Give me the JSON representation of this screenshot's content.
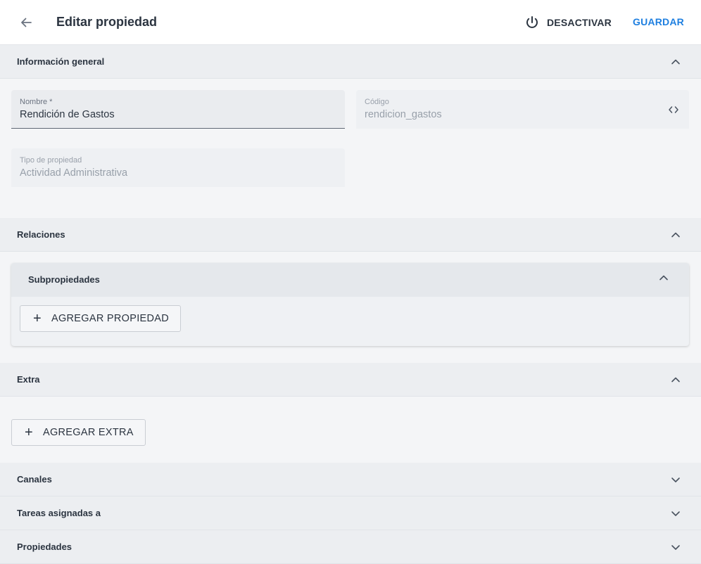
{
  "header": {
    "title": "Editar propiedad",
    "back_icon": "arrow-left-icon",
    "deactivate_label": "DESACTIVAR",
    "deactivate_icon": "power-icon",
    "save_label": "GUARDAR",
    "save_color": "#1e7fe0"
  },
  "sections": {
    "general": {
      "title": "Información general",
      "expanded": true,
      "fields": {
        "name": {
          "label": "Nombre *",
          "value": "Rendición de Gastos"
        },
        "code": {
          "label": "Código",
          "value": "rendicion_gastos",
          "icon": "code-icon"
        },
        "type": {
          "label": "Tipo de propiedad",
          "value": "Actividad Administrativa"
        }
      }
    },
    "relations": {
      "title": "Relaciones",
      "expanded": true,
      "subproperties": {
        "title": "Subpropiedades",
        "expanded": true,
        "add_label": "AGREGAR PROPIEDAD"
      }
    },
    "extra": {
      "title": "Extra",
      "expanded": true,
      "add_label": "AGREGAR EXTRA"
    },
    "channels": {
      "title": "Canales",
      "expanded": false
    },
    "tasks": {
      "title": "Tareas asignadas a",
      "expanded": false
    },
    "properties": {
      "title": "Propiedades",
      "expanded": false
    }
  }
}
